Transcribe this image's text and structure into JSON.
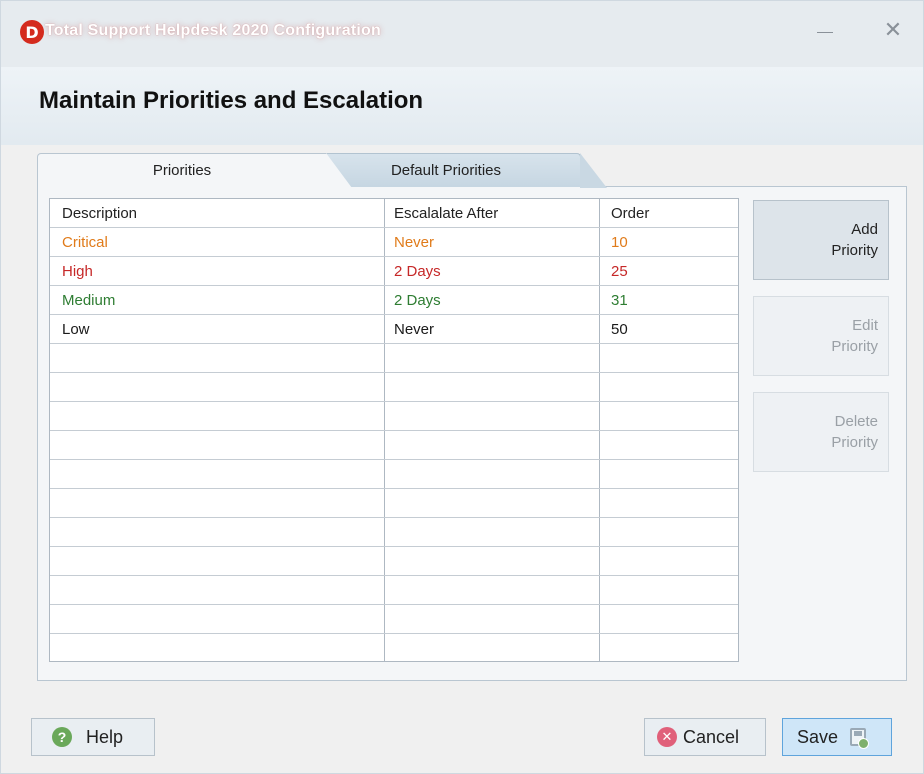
{
  "window": {
    "app_icon_letter": "D",
    "title": "Total Support Helpdesk 2020 Configuration",
    "minimize_icon": "minimize-icon",
    "close_icon": "close-icon",
    "close_glyph": "✕"
  },
  "header": {
    "title": "Maintain Priorities and Escalation"
  },
  "tabs": [
    {
      "label": "Priorities",
      "active": true
    },
    {
      "label": "Default Priorities",
      "active": false
    }
  ],
  "grid": {
    "columns": [
      "Description",
      "Escalalate After",
      "Order"
    ],
    "rows": [
      {
        "description": "Critical",
        "escalate_after": "Never",
        "order": "10",
        "color": "#e07b1a"
      },
      {
        "description": "High",
        "escalate_after": "2 Days",
        "order": "25",
        "color": "#c62828"
      },
      {
        "description": "Medium",
        "escalate_after": "2 Days",
        "order": "31",
        "color": "#2e7d32"
      },
      {
        "description": "Low",
        "escalate_after": "Never",
        "order": "50",
        "color": "#1a1a1a"
      }
    ],
    "empty_row_count": 11
  },
  "side_buttons": {
    "add": {
      "line1": "Add",
      "line2": "Priority",
      "enabled": true
    },
    "edit": {
      "line1": "Edit",
      "line2": "Priority",
      "enabled": false
    },
    "delete": {
      "line1": "Delete",
      "line2": "Priority",
      "enabled": false
    }
  },
  "footer": {
    "help_label": "Help",
    "help_icon": "help-icon",
    "cancel_label": "Cancel",
    "cancel_icon": "cancel-icon",
    "save_label": "Save",
    "save_icon": "save-icon"
  }
}
